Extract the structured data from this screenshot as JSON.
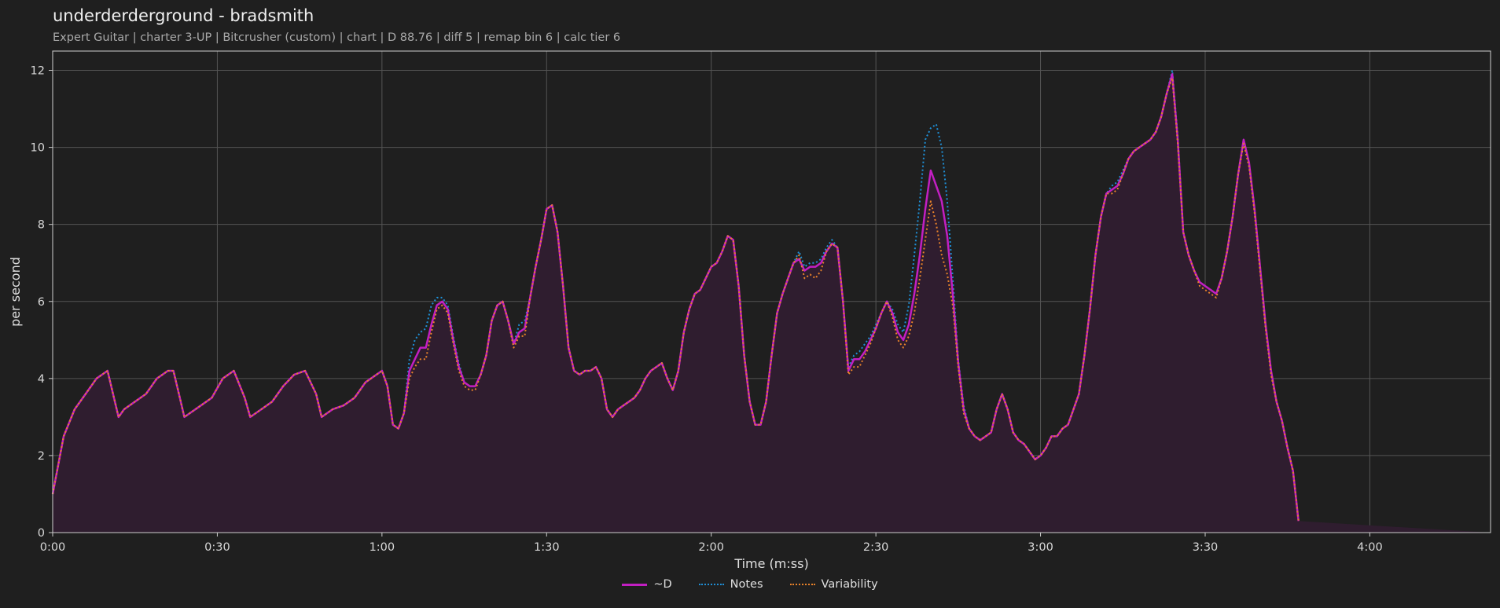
{
  "header": {
    "title": "underderderground - bradsmith",
    "subtitle": "Expert Guitar  |  charter 3-UP  |  Bitcrusher (custom)  |  chart  |  D 88.76  |  diff 5  |  remap bin 6  |  calc tier 6"
  },
  "colors": {
    "background": "#1f1f1f",
    "d": "#c21fc2",
    "notes": "#1f8fd6",
    "variability": "#e8822a",
    "fill": "#2f1d2f"
  },
  "chart_data": {
    "type": "line",
    "title": "",
    "xlabel": "Time (m:ss)",
    "ylabel": "per second",
    "xlim": [
      0,
      262
    ],
    "ylim": [
      0,
      12.5
    ],
    "xticks": [
      {
        "v": 0,
        "label": "0:00"
      },
      {
        "v": 30,
        "label": "0:30"
      },
      {
        "v": 60,
        "label": "1:00"
      },
      {
        "v": 90,
        "label": "1:30"
      },
      {
        "v": 120,
        "label": "2:00"
      },
      {
        "v": 150,
        "label": "2:30"
      },
      {
        "v": 180,
        "label": "3:00"
      },
      {
        "v": 210,
        "label": "3:30"
      },
      {
        "v": 240,
        "label": "4:00"
      }
    ],
    "yticks": [
      {
        "v": 0,
        "label": "0"
      },
      {
        "v": 2,
        "label": "2"
      },
      {
        "v": 4,
        "label": "4"
      },
      {
        "v": 6,
        "label": "6"
      },
      {
        "v": 8,
        "label": "8"
      },
      {
        "v": 10,
        "label": "10"
      },
      {
        "v": 12,
        "label": "12"
      }
    ],
    "grid": true,
    "legend_position": "bottom-center",
    "x": [
      0,
      2,
      4,
      6,
      8,
      10,
      11,
      12,
      13,
      15,
      17,
      19,
      21,
      22,
      23,
      24,
      25,
      27,
      29,
      31,
      33,
      35,
      36,
      37,
      38,
      40,
      42,
      44,
      46,
      48,
      49,
      50,
      51,
      53,
      55,
      57,
      59,
      60,
      61,
      62,
      63,
      64,
      65,
      66,
      67,
      68,
      69,
      70,
      71,
      72,
      73,
      74,
      75,
      76,
      77,
      78,
      79,
      80,
      81,
      82,
      83,
      84,
      85,
      86,
      87,
      88,
      89,
      90,
      91,
      92,
      93,
      94,
      95,
      96,
      97,
      98,
      99,
      100,
      101,
      102,
      103,
      104,
      105,
      106,
      107,
      108,
      109,
      110,
      111,
      112,
      113,
      114,
      115,
      116,
      117,
      118,
      119,
      120,
      121,
      122,
      123,
      124,
      125,
      126,
      127,
      128,
      129,
      130,
      131,
      132,
      133,
      134,
      135,
      136,
      137,
      138,
      139,
      140,
      141,
      142,
      143,
      144,
      145,
      146,
      147,
      148,
      149,
      150,
      151,
      152,
      153,
      154,
      155,
      156,
      157,
      158,
      159,
      160,
      161,
      162,
      163,
      164,
      165,
      166,
      167,
      168,
      169,
      170,
      171,
      172,
      173,
      174,
      175,
      176,
      177,
      178,
      179,
      180,
      181,
      182,
      183,
      184,
      185,
      186,
      187,
      188,
      189,
      190,
      191,
      192,
      193,
      194,
      195,
      196,
      197,
      198,
      199,
      200,
      201,
      202,
      203,
      204,
      205,
      206,
      207,
      208,
      209,
      210,
      211,
      212,
      213,
      214,
      215,
      216,
      217,
      218,
      219,
      220,
      221,
      222,
      223,
      224,
      225,
      226,
      227,
      228,
      229,
      230,
      231,
      232,
      233,
      234,
      235,
      236,
      237,
      238,
      239,
      240,
      241,
      242,
      243,
      244,
      245,
      246,
      247,
      248,
      249,
      250,
      251,
      252,
      253,
      254,
      255,
      256,
      257,
      258,
      259,
      260,
      261,
      262
    ],
    "series": [
      {
        "name": "~D",
        "values": [
          1.0,
          2.5,
          3.2,
          3.6,
          4.0,
          4.2,
          3.6,
          3.0,
          3.2,
          3.4,
          3.6,
          4.0,
          4.2,
          4.2,
          3.6,
          3.0,
          3.1,
          3.3,
          3.5,
          4.0,
          4.2,
          3.5,
          3.0,
          3.1,
          3.2,
          3.4,
          3.8,
          4.1,
          4.2,
          3.6,
          3.0,
          3.1,
          3.2,
          3.3,
          3.5,
          3.9,
          4.1,
          4.2,
          3.8,
          2.8,
          2.7,
          3.1,
          4.2,
          4.5,
          4.8,
          4.8,
          5.4,
          5.9,
          6.0,
          5.8,
          5.0,
          4.3,
          3.9,
          3.8,
          3.8,
          4.1,
          4.6,
          5.5,
          5.9,
          6.0,
          5.5,
          4.9,
          5.2,
          5.3,
          6.1,
          6.9,
          7.6,
          8.4,
          8.5,
          7.8,
          6.4,
          4.8,
          4.2,
          4.1,
          4.2,
          4.2,
          4.3,
          4.0,
          3.2,
          3.0,
          3.2,
          3.3,
          3.4,
          3.5,
          3.7,
          4.0,
          4.2,
          4.3,
          4.4,
          4.0,
          3.7,
          4.2,
          5.2,
          5.8,
          6.2,
          6.3,
          6.6,
          6.9,
          7.0,
          7.3,
          7.7,
          7.6,
          6.4,
          4.6,
          3.4,
          2.8,
          2.8,
          3.4,
          4.6,
          5.7,
          6.2,
          6.6,
          7.0,
          7.1,
          6.8,
          6.9,
          6.9,
          7.0,
          7.3,
          7.5,
          7.4,
          6.0,
          4.2,
          4.5,
          4.5,
          4.7,
          5.0,
          5.3,
          5.7,
          6.0,
          5.7,
          5.2,
          5.0,
          5.4,
          6.2,
          7.2,
          8.4,
          9.4,
          9.0,
          8.6,
          7.7,
          6.2,
          4.4,
          3.2,
          2.7,
          2.5,
          2.4,
          2.5,
          2.6,
          3.2,
          3.6,
          3.2,
          2.6,
          2.4,
          2.3,
          2.1,
          1.9,
          2.0,
          2.2,
          2.5,
          2.5,
          2.7,
          2.8,
          3.2,
          3.6,
          4.6,
          5.8,
          7.2,
          8.2,
          8.8,
          8.9,
          9.0,
          9.3,
          9.7,
          9.9,
          10.0,
          10.1,
          10.2,
          10.4,
          10.8,
          11.4,
          11.9,
          10.2,
          7.8,
          7.2,
          6.8,
          6.5,
          6.4,
          6.3,
          6.2,
          6.6,
          7.3,
          8.2,
          9.3,
          10.2,
          9.6,
          8.4,
          6.9,
          5.4,
          4.2,
          3.4,
          2.9,
          2.2,
          1.6,
          0.3
        ]
      },
      {
        "name": "Notes",
        "values": [
          1.0,
          2.5,
          3.2,
          3.6,
          4.0,
          4.2,
          3.6,
          3.0,
          3.2,
          3.4,
          3.6,
          4.0,
          4.2,
          4.2,
          3.6,
          3.0,
          3.1,
          3.3,
          3.5,
          4.0,
          4.2,
          3.5,
          3.0,
          3.1,
          3.2,
          3.4,
          3.8,
          4.1,
          4.2,
          3.6,
          3.0,
          3.1,
          3.2,
          3.3,
          3.5,
          3.9,
          4.1,
          4.2,
          3.8,
          2.8,
          2.7,
          3.1,
          4.5,
          5.0,
          5.2,
          5.3,
          5.9,
          6.1,
          6.1,
          5.9,
          5.1,
          4.4,
          3.9,
          3.8,
          3.8,
          4.1,
          4.6,
          5.5,
          5.9,
          6.0,
          5.5,
          4.9,
          5.4,
          5.5,
          6.1,
          6.9,
          7.6,
          8.4,
          8.5,
          7.8,
          6.4,
          4.8,
          4.2,
          4.1,
          4.2,
          4.2,
          4.3,
          4.0,
          3.2,
          3.0,
          3.2,
          3.3,
          3.4,
          3.5,
          3.7,
          4.0,
          4.2,
          4.3,
          4.4,
          4.0,
          3.7,
          4.2,
          5.2,
          5.8,
          6.2,
          6.3,
          6.6,
          6.9,
          7.0,
          7.3,
          7.7,
          7.6,
          6.4,
          4.6,
          3.4,
          2.8,
          2.8,
          3.4,
          4.6,
          5.7,
          6.2,
          6.6,
          7.0,
          7.3,
          6.9,
          7.0,
          7.0,
          7.1,
          7.4,
          7.6,
          7.4,
          6.0,
          4.3,
          4.6,
          4.7,
          4.9,
          5.1,
          5.4,
          5.7,
          6.0,
          5.8,
          5.4,
          5.2,
          5.9,
          7.2,
          8.6,
          10.2,
          10.5,
          10.6,
          10.0,
          8.6,
          6.6,
          4.5,
          3.3,
          2.7,
          2.5,
          2.4,
          2.5,
          2.6,
          3.2,
          3.6,
          3.2,
          2.6,
          2.4,
          2.3,
          2.1,
          1.9,
          2.0,
          2.2,
          2.5,
          2.5,
          2.7,
          2.8,
          3.2,
          3.6,
          4.6,
          5.8,
          7.2,
          8.2,
          8.8,
          9.0,
          9.1,
          9.4,
          9.7,
          9.9,
          10.0,
          10.1,
          10.2,
          10.4,
          10.8,
          11.4,
          12.0,
          10.3,
          7.8,
          7.2,
          6.8,
          6.5,
          6.4,
          6.3,
          6.2,
          6.6,
          7.3,
          8.2,
          9.3,
          10.2,
          9.6,
          8.4,
          6.9,
          5.4,
          4.2,
          3.4,
          2.9,
          2.2,
          1.6,
          0.3
        ]
      },
      {
        "name": "Variability",
        "values": [
          1.0,
          2.5,
          3.2,
          3.6,
          4.0,
          4.2,
          3.6,
          3.0,
          3.2,
          3.4,
          3.6,
          4.0,
          4.2,
          4.2,
          3.6,
          3.0,
          3.1,
          3.3,
          3.5,
          4.0,
          4.2,
          3.5,
          3.0,
          3.1,
          3.2,
          3.4,
          3.8,
          4.1,
          4.2,
          3.6,
          3.0,
          3.1,
          3.2,
          3.3,
          3.5,
          3.9,
          4.1,
          4.2,
          3.8,
          2.8,
          2.7,
          3.1,
          4.0,
          4.3,
          4.5,
          4.5,
          5.2,
          5.8,
          5.9,
          5.7,
          4.9,
          4.2,
          3.8,
          3.7,
          3.7,
          4.1,
          4.6,
          5.5,
          5.9,
          6.0,
          5.5,
          4.8,
          5.1,
          5.1,
          6.1,
          6.9,
          7.6,
          8.4,
          8.5,
          7.8,
          6.4,
          4.8,
          4.2,
          4.1,
          4.2,
          4.2,
          4.3,
          4.0,
          3.2,
          3.0,
          3.2,
          3.3,
          3.4,
          3.5,
          3.7,
          4.0,
          4.2,
          4.3,
          4.4,
          4.0,
          3.7,
          4.2,
          5.2,
          5.8,
          6.2,
          6.3,
          6.6,
          6.9,
          7.0,
          7.3,
          7.7,
          7.6,
          6.4,
          4.6,
          3.4,
          2.8,
          2.8,
          3.4,
          4.6,
          5.7,
          6.2,
          6.6,
          7.0,
          7.2,
          6.6,
          6.7,
          6.6,
          6.8,
          7.3,
          7.5,
          7.4,
          6.0,
          4.1,
          4.3,
          4.3,
          4.6,
          4.9,
          5.3,
          5.7,
          6.0,
          5.6,
          5.0,
          4.8,
          5.1,
          5.7,
          6.6,
          7.6,
          8.6,
          8.0,
          7.2,
          6.7,
          5.9,
          4.3,
          3.1,
          2.7,
          2.5,
          2.4,
          2.5,
          2.6,
          3.2,
          3.6,
          3.2,
          2.6,
          2.4,
          2.3,
          2.1,
          1.9,
          2.0,
          2.2,
          2.5,
          2.5,
          2.7,
          2.8,
          3.2,
          3.6,
          4.6,
          5.8,
          7.2,
          8.2,
          8.8,
          8.8,
          8.9,
          9.3,
          9.7,
          9.9,
          10.0,
          10.1,
          10.2,
          10.4,
          10.8,
          11.4,
          11.8,
          10.1,
          7.8,
          7.2,
          6.8,
          6.4,
          6.3,
          6.2,
          6.1,
          6.6,
          7.3,
          8.2,
          9.3,
          10.1,
          9.5,
          8.3,
          6.8,
          5.3,
          4.1,
          3.4,
          2.9,
          2.2,
          1.6,
          0.3
        ]
      }
    ]
  }
}
